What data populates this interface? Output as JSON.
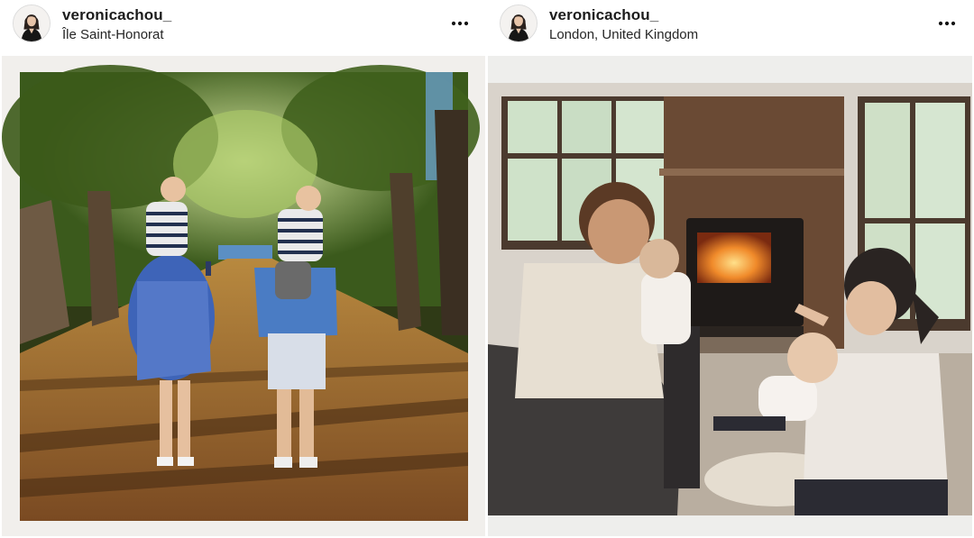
{
  "posts": [
    {
      "username": "veronicachou_",
      "location": "Île Saint-Honorat",
      "avatar_icon": "profile-avatar",
      "menu_icon": "more-options-icon",
      "photo_subject": "family-walk-tree-lined-path"
    },
    {
      "username": "veronicachou_",
      "location": "London, United Kingdom",
      "avatar_icon": "profile-avatar",
      "menu_icon": "more-options-icon",
      "photo_subject": "family-by-wood-stove-fireplace"
    }
  ],
  "colors": {
    "text_primary": "#1c1c1c",
    "text_secondary": "#262626",
    "background": "#ffffff"
  }
}
